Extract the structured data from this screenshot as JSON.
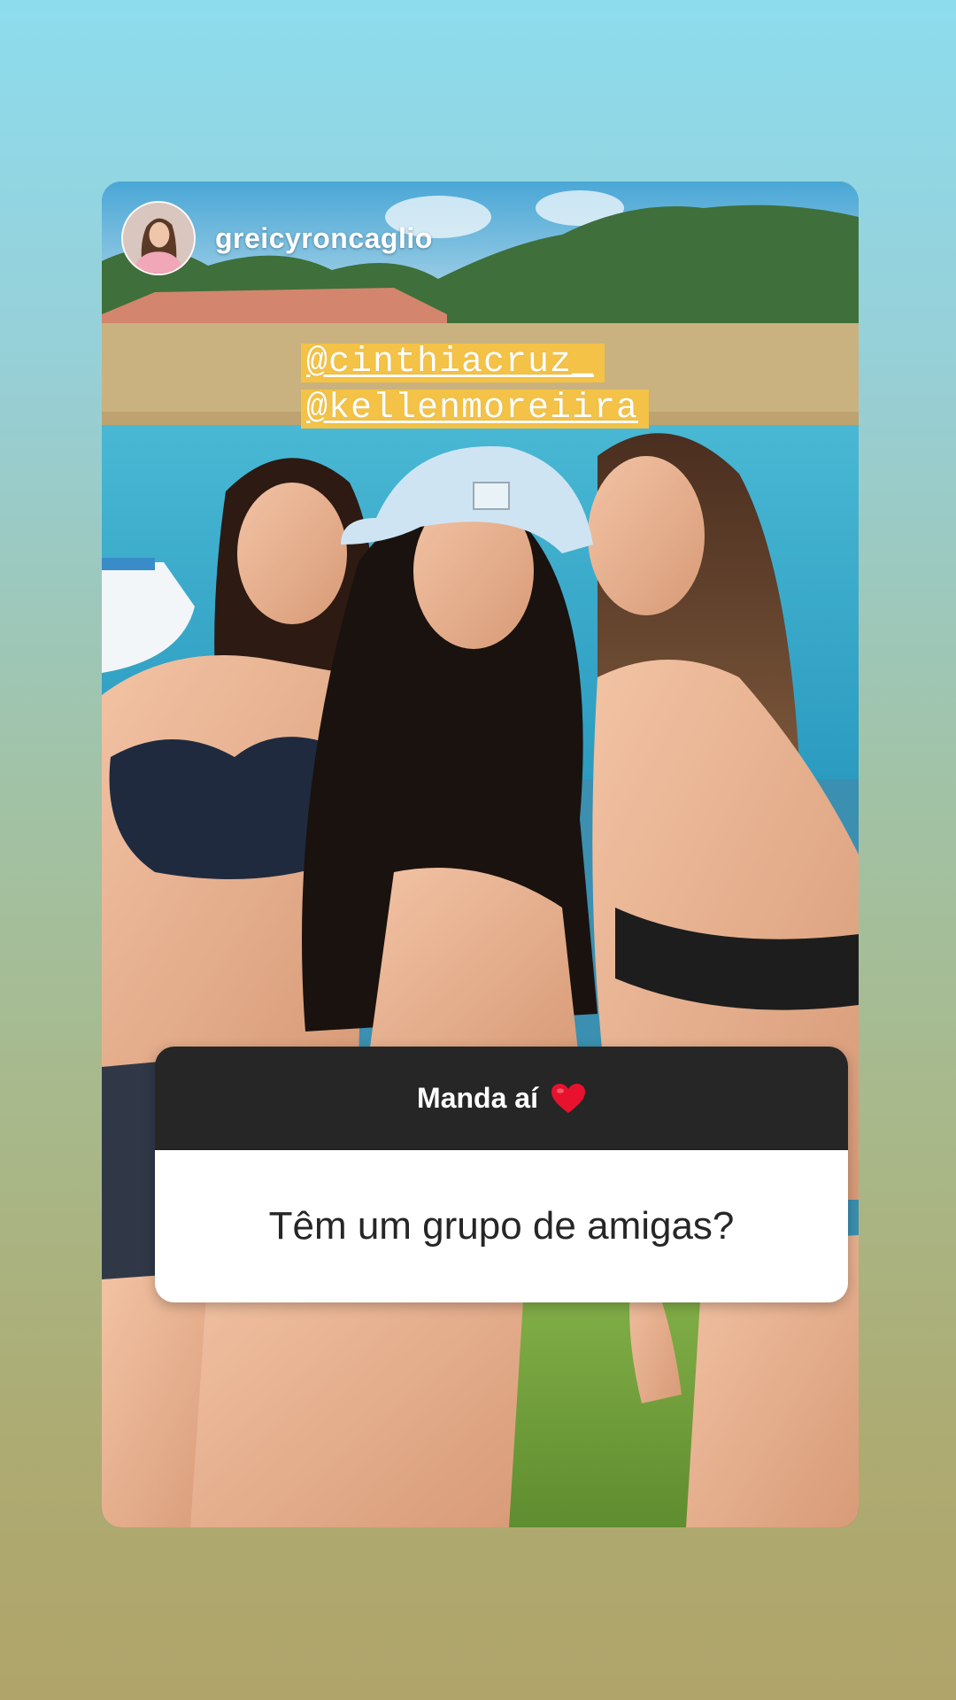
{
  "story": {
    "username": "greicyroncaglio",
    "mentions": [
      "@cinthiacruz_",
      "@kellenmoreiira"
    ],
    "photo_description": "three-women-at-lake",
    "colors": {
      "mention_highlight": "#f3c246",
      "sticker_header": "#262626",
      "sticker_body": "#ffffff"
    }
  },
  "question_sticker": {
    "prompt": "Manda aí",
    "prompt_icon": "red-heart-icon",
    "question": "Têm um grupo de amigas?"
  }
}
